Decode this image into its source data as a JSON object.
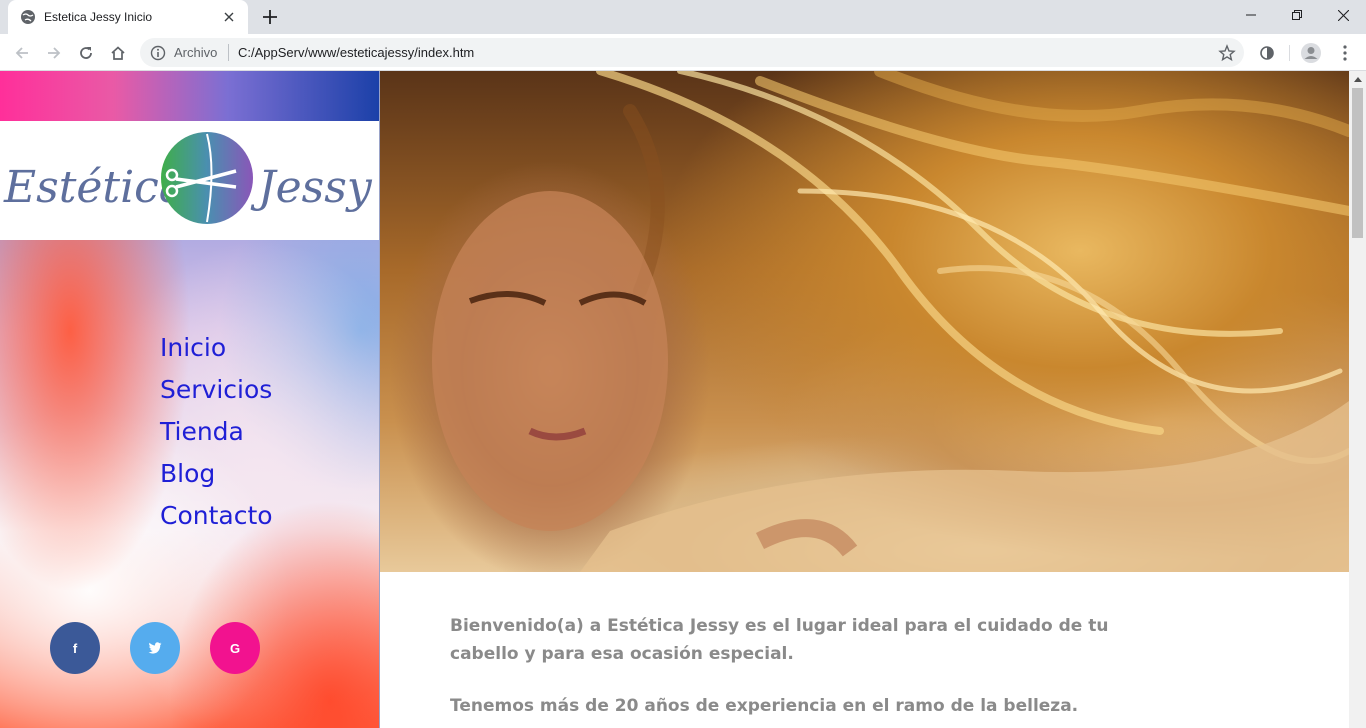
{
  "browser": {
    "tab_title": "Estetica Jessy Inicio",
    "omnibox": {
      "scheme_label": "Archivo",
      "url": "C:/AppServ/www/esteticajessy/index.htm"
    }
  },
  "page": {
    "logo": {
      "left_text": "Estética",
      "right_text": "Jessy"
    },
    "nav": [
      {
        "label": "Inicio"
      },
      {
        "label": "Servicios"
      },
      {
        "label": "Tienda"
      },
      {
        "label": "Blog"
      },
      {
        "label": "Contacto"
      }
    ],
    "social": {
      "facebook": "f",
      "twitter": "t",
      "google": "G"
    },
    "content": {
      "welcome": "Bienvenido(a) a Estética Jessy es el lugar ideal para el cuidado de tu cabello y para esa ocasión especial.",
      "experience": "Tenemos más de 20 años de experiencia en el ramo de la belleza."
    }
  },
  "colors": {
    "nav_link": "#1f1fd6",
    "facebook": "#3b5998",
    "twitter": "#55acee",
    "google": "#f2128f",
    "body_text": "#8a8a8a"
  }
}
